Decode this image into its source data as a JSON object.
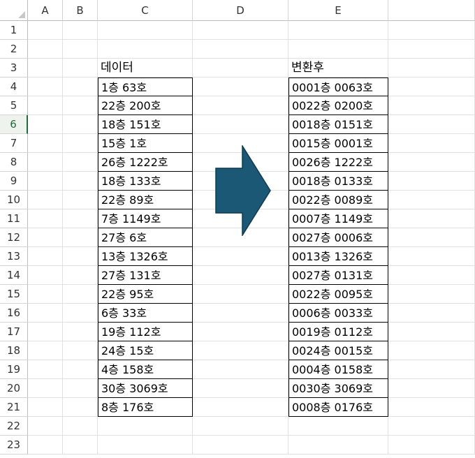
{
  "sheet": {
    "columns": [
      "A",
      "B",
      "C",
      "D",
      "E"
    ],
    "rows": [
      "1",
      "2",
      "3",
      "4",
      "5",
      "6",
      "7",
      "8",
      "9",
      "10",
      "11",
      "12",
      "13",
      "14",
      "15",
      "16",
      "17",
      "18",
      "19",
      "20",
      "21",
      "22",
      "23"
    ],
    "selected_row": "6"
  },
  "table_left": {
    "header": "데이터",
    "values": [
      "1층 63호",
      "22층 200호",
      "18층 151호",
      "15층 1호",
      "26층 1222호",
      "18층 133호",
      "22층 89호",
      "7층 1149호",
      "27층 6호",
      "13층 1326호",
      "27층 131호",
      "22층 95호",
      "6층 33호",
      "19층 112호",
      "24층 15호",
      "4층 158호",
      "30층 3069호",
      "8층 176호"
    ]
  },
  "table_right": {
    "header": "변환후",
    "values": [
      "0001층 0063호",
      "0022층 0200호",
      "0018층 0151호",
      "0015층 0001호",
      "0026층 1222호",
      "0018층 0133호",
      "0022층 0089호",
      "0007층 1149호",
      "0027층 0006호",
      "0013층 1326호",
      "0027층 0131호",
      "0022층 0095호",
      "0006층 0033호",
      "0019층 0112호",
      "0024층 0015호",
      "0004층 0158호",
      "0030층 3069호",
      "0008층 0176호"
    ]
  },
  "arrow": {
    "icon": "right-arrow-shape",
    "fill": "#1a5876",
    "stroke": "#0f3a4f"
  },
  "colors": {
    "selected_row_header": "#1e6b3a",
    "gridline": "#e1e1e1"
  }
}
